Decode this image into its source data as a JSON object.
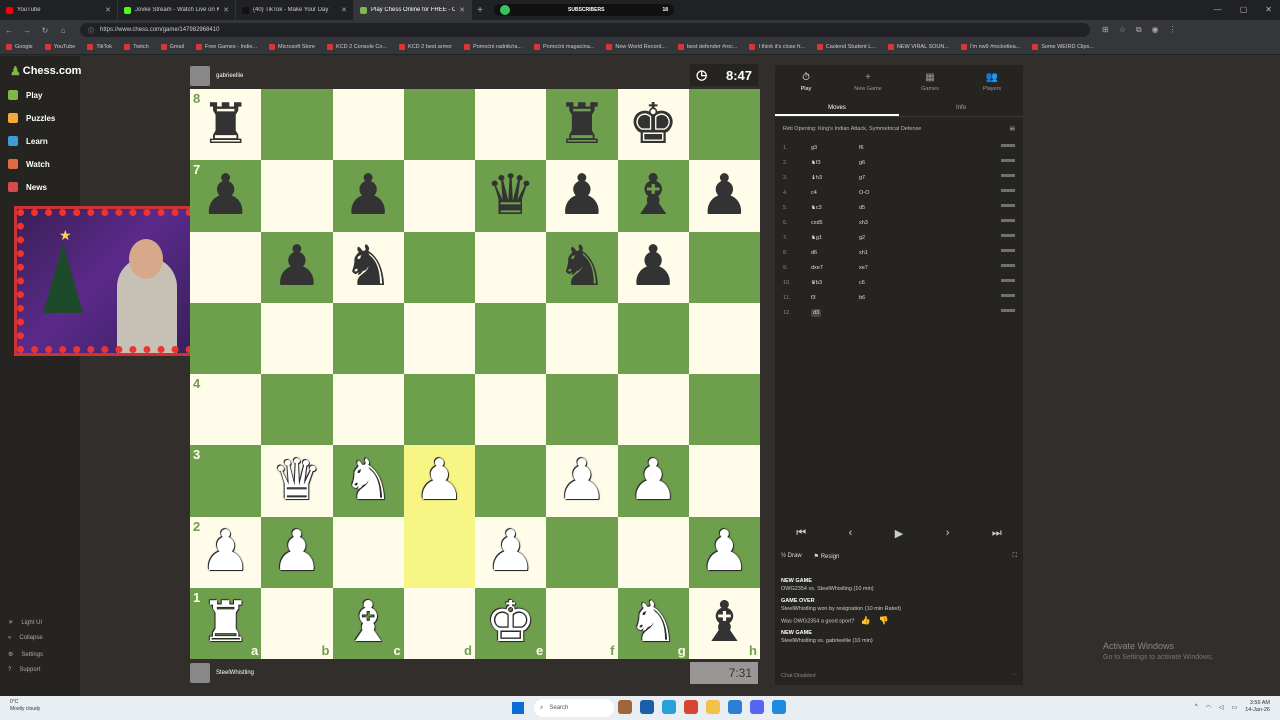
{
  "browser": {
    "tabs": [
      {
        "title": "YouTube",
        "color": "#ff0000",
        "active": false
      },
      {
        "title": "Jovke Stream - Watch Live on Kick",
        "color": "#53fc18",
        "active": false
      },
      {
        "title": "(40) TikTok - Make Your Day",
        "color": "#111111",
        "active": false
      },
      {
        "title": "Play Chess Online for FREE - C",
        "color": "#81b64c",
        "active": true
      }
    ],
    "new_tab": "+",
    "subscribers_label": "SUBSCRIBERS",
    "subscribers_count": "18",
    "url": "https://www.chess.com/game/147982968410",
    "bookmarks": [
      "Google",
      "YouTube",
      "TikTok",
      "Twitch",
      "Gmail",
      "Free Games - Indie...",
      "Microsoft Store",
      "KCD 2 Console Co...",
      "KCD 2 best armor",
      "Pomoćni radnik/ra...",
      "Pomoćni magacina...",
      "New World Record...",
      "best defender #roc...",
      "I think it's close fr...",
      "Caolend Student L...",
      "NEW VIRAL SOUN...",
      "I'm nw9 #rocketlea...",
      "Some WEIRD Clips..."
    ]
  },
  "sidebar": {
    "logo": "Chess.com",
    "items": [
      {
        "label": "Play",
        "color": "#81b64c"
      },
      {
        "label": "Puzzles",
        "color": "#f2a83a"
      },
      {
        "label": "Learn",
        "color": "#3b9cd6"
      },
      {
        "label": "Watch",
        "color": "#e06a43"
      },
      {
        "label": "News",
        "color": "#d54b4b"
      }
    ],
    "bottom": [
      "Light UI",
      "Collapse",
      "Settings",
      "Support"
    ]
  },
  "game": {
    "top_player": {
      "name": "gabrieellie",
      "clock": "8:47"
    },
    "bottom_player": {
      "name": "SteelWhistling",
      "clock": "7:31"
    },
    "files": [
      "a",
      "b",
      "c",
      "d",
      "e",
      "f",
      "g",
      "h"
    ],
    "ranks": [
      "8",
      "7",
      "6",
      "5",
      "4",
      "3",
      "2",
      "1"
    ],
    "board": [
      [
        "r",
        "",
        "",
        "",
        "",
        "r",
        "k",
        ""
      ],
      [
        "p",
        "",
        "p",
        "",
        "q",
        "p",
        "b",
        "p"
      ],
      [
        "",
        "p",
        "n",
        "",
        "",
        "n",
        "p",
        ""
      ],
      [
        "",
        "",
        "",
        "",
        "",
        "",
        "",
        ""
      ],
      [
        "",
        "",
        "",
        "",
        "",
        "",
        "",
        ""
      ],
      [
        "",
        "Q",
        "N",
        "P",
        "",
        "P",
        "P",
        ""
      ],
      [
        "P",
        "P",
        "",
        "",
        "P",
        "",
        "",
        "P"
      ],
      [
        "R",
        "",
        "B",
        "",
        "K",
        "",
        "N",
        "b"
      ]
    ],
    "highlight": [
      [
        5,
        3
      ],
      [
        6,
        3
      ]
    ],
    "piece_glyphs": {
      "k": "♚",
      "q": "♛",
      "r": "♜",
      "b": "♝",
      "n": "♞",
      "p": "♟",
      "K": "♚",
      "Q": "♛",
      "R": "♜",
      "B": "♝",
      "N": "♞",
      "P": "♟"
    },
    "ranks_shown": [
      "8",
      "7",
      "4",
      "3",
      "2",
      "1"
    ],
    "files_shown": [
      "a",
      "b",
      "c",
      "d",
      "e",
      "f",
      "g",
      "h"
    ]
  },
  "panel": {
    "tabs": [
      {
        "label": "Play",
        "icon": "⏱"
      },
      {
        "label": "New Game",
        "icon": "+"
      },
      {
        "label": "Games",
        "icon": "▦"
      },
      {
        "label": "Players",
        "icon": "👥"
      }
    ],
    "subtabs": [
      "Moves",
      "Info"
    ],
    "opening": "Réti Opening: King's Indian Attack, Symmetrical Defense",
    "moves": [
      {
        "n": "1.",
        "w": "g3",
        "b": "f6"
      },
      {
        "n": "2.",
        "w": "♞f3",
        "b": "g6"
      },
      {
        "n": "3.",
        "w": "♝h3",
        "b": "g7"
      },
      {
        "n": "4.",
        "w": "c4",
        "b": "O-O"
      },
      {
        "n": "5.",
        "w": "♞c3",
        "b": "d5"
      },
      {
        "n": "6.",
        "w": "cxd5",
        "b": "xh3"
      },
      {
        "n": "7.",
        "w": "♞g1",
        "b": "g2"
      },
      {
        "n": "8.",
        "w": "d6",
        "b": "xh1"
      },
      {
        "n": "9.",
        "w": "dxe7",
        "b": "xe7"
      },
      {
        "n": "10.",
        "w": "♛b3",
        "b": "c6"
      },
      {
        "n": "11.",
        "w": "f3",
        "b": "b6"
      },
      {
        "n": "12.",
        "w": "d3",
        "b": ""
      }
    ],
    "controls": [
      "⏮",
      "‹",
      "▶",
      "›",
      "⏭"
    ],
    "draw": "½ Draw",
    "resign": "⚑ Resign",
    "chat": [
      {
        "head": "NEW GAME",
        "text": "OWG2354 vs. SteelWhistling (10 min)"
      },
      {
        "head": "GAME OVER",
        "text": "SteelWhistling won by resignation (10 min Rated)"
      },
      {
        "head": "",
        "text": "Was OWG2354 a good sport?"
      },
      {
        "head": "NEW GAME",
        "text": "SteelWhistling vs. gabrieellie (10 min)"
      }
    ],
    "chat_disabled": "Chat Disabled"
  },
  "windows": {
    "activate_title": "Activate Windows",
    "activate_sub": "Go to Settings to activate Windows.",
    "weather_temp": "0°C",
    "weather_desc": "Mostly cloudy",
    "search": "Search",
    "time": "3:56 AM",
    "date": "14-Jan-26"
  }
}
